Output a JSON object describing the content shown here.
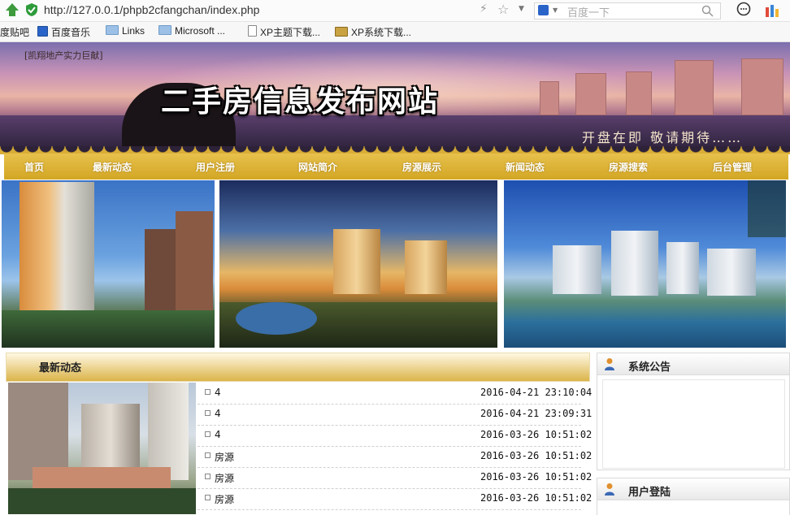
{
  "browser": {
    "url": "http://127.0.0.1/phpb2cfangchan/index.php",
    "search_placeholder": "百度一下",
    "bookmarks": [
      "度贴吧",
      "百度音乐",
      "Links",
      "Microsoft ...",
      "XP主题下载...",
      "XP系统下载..."
    ]
  },
  "banner": {
    "tagline": "[凯翔地产实力巨献]",
    "title": "二手房信息发布网站",
    "slogan": "开盘在即  敬请期待……"
  },
  "nav": {
    "items": [
      "首页",
      "最新动态",
      "用户注册",
      "网站简介",
      "房源展示",
      "新闻动态",
      "房源搜索",
      "后台管理"
    ]
  },
  "news": {
    "title": "最新动态",
    "rows": [
      {
        "title": "4",
        "date": "2016-04-21 23:10:04"
      },
      {
        "title": "4",
        "date": "2016-04-21 23:09:31"
      },
      {
        "title": "4",
        "date": "2016-03-26 10:51:02"
      },
      {
        "title": "房源",
        "date": "2016-03-26 10:51:02"
      },
      {
        "title": "房源",
        "date": "2016-03-26 10:51:02"
      },
      {
        "title": "房源",
        "date": "2016-03-26 10:51:02"
      }
    ]
  },
  "sidebar": {
    "notice_title": "系统公告",
    "login_title": "用户登陆"
  },
  "colors": {
    "nav_gold": "#d9ad36",
    "panel_gold": "#dbb44a"
  }
}
